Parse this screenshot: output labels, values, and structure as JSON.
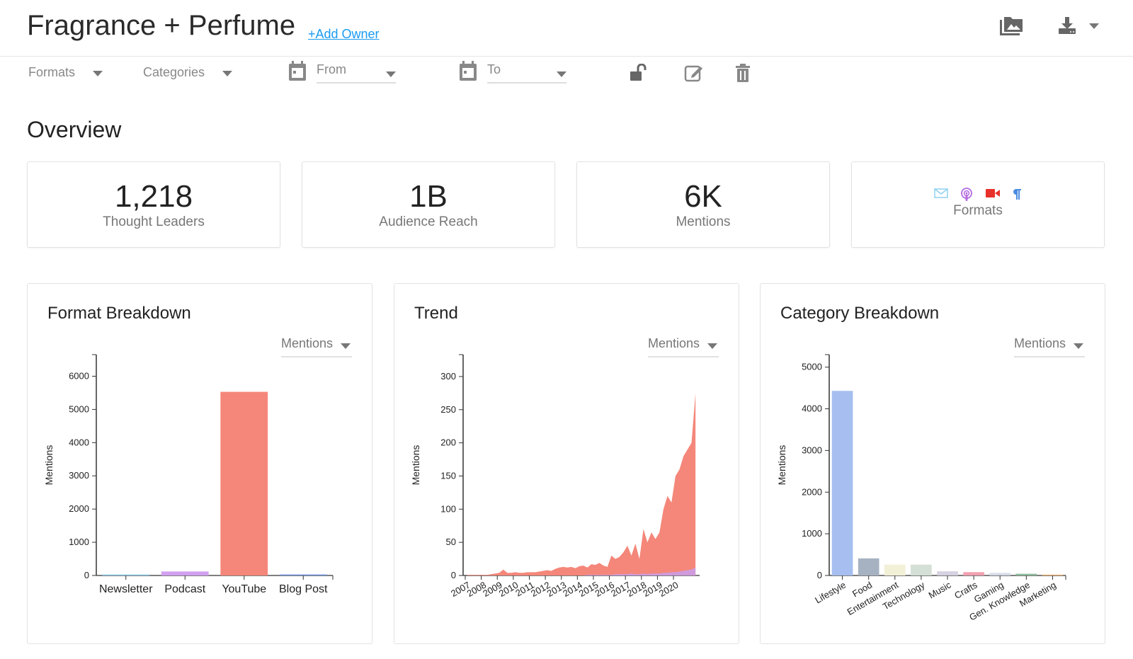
{
  "header": {
    "title": "Fragrance + Perfume",
    "add_owner": "+Add Owner",
    "icons": [
      "gallery-icon",
      "download-icon",
      "chevron-down-icon"
    ]
  },
  "toolbar": {
    "formats": "Formats",
    "categories": "Categories",
    "from": "From",
    "to": "To",
    "icons": [
      "calendar-icon",
      "lock-open-icon",
      "edit-icon",
      "trash-icon"
    ]
  },
  "overview": {
    "title": "Overview",
    "cards": [
      {
        "value": "1,218",
        "label": "Thought Leaders"
      },
      {
        "value": "1B",
        "label": "Audience Reach"
      },
      {
        "value": "6K",
        "label": "Mentions"
      },
      {
        "label": "Formats",
        "icons": [
          "mail-icon",
          "podcast-icon",
          "video-icon",
          "paragraph-icon"
        ],
        "icon_colors": [
          "#8fd0f0",
          "#b46ae0",
          "#e8312a",
          "#4a8be0"
        ]
      }
    ]
  },
  "panels": [
    {
      "title": "Format Breakdown",
      "metric": "Mentions"
    },
    {
      "title": "Trend",
      "metric": "Mentions"
    },
    {
      "title": "Category Breakdown",
      "metric": "Mentions"
    }
  ],
  "chart_data": [
    {
      "type": "bar",
      "title": "Format Breakdown",
      "ylabel": "Mentions",
      "ylim": [
        0,
        6650
      ],
      "yticks": [
        0,
        1000,
        2000,
        3000,
        4000,
        5000,
        6000
      ],
      "categories": [
        "Newsletter",
        "Podcast",
        "YouTube",
        "Blog Post"
      ],
      "values": [
        30,
        120,
        5530,
        30
      ],
      "colors": [
        "#8fd0f0",
        "#d2a0f0",
        "#f4877a",
        "#6f94e0"
      ]
    },
    {
      "type": "area",
      "title": "Trend",
      "ylabel": "Mentions",
      "ylim": [
        0,
        333
      ],
      "yticks": [
        0,
        50,
        100,
        150,
        200,
        250,
        300
      ],
      "xticks": [
        "2007",
        "2008",
        "2009",
        "2010",
        "2011",
        "2012",
        "2013",
        "2014",
        "2015",
        "2016",
        "2017",
        "2018",
        "2019",
        "2020"
      ],
      "x": [
        "2007-Q1",
        "2007-Q2",
        "2007-Q3",
        "2007-Q4",
        "2008-Q1",
        "2008-Q2",
        "2008-Q3",
        "2008-Q4",
        "2009-Q1",
        "2009-Q2",
        "2009-Q3",
        "2009-Q4",
        "2010-Q1",
        "2010-Q2",
        "2010-Q3",
        "2010-Q4",
        "2011-Q1",
        "2011-Q2",
        "2011-Q3",
        "2011-Q4",
        "2012-Q1",
        "2012-Q2",
        "2012-Q3",
        "2012-Q4",
        "2013-Q1",
        "2013-Q2",
        "2013-Q3",
        "2013-Q4",
        "2014-Q1",
        "2014-Q2",
        "2014-Q3",
        "2014-Q4",
        "2015-Q1",
        "2015-Q2",
        "2015-Q3",
        "2015-Q4",
        "2016-Q1",
        "2016-Q2",
        "2016-Q3",
        "2016-Q4",
        "2017-Q1",
        "2017-Q2",
        "2017-Q3",
        "2017-Q4",
        "2018-Q1",
        "2018-Q2",
        "2018-Q3",
        "2018-Q4",
        "2019-Q1",
        "2019-Q2",
        "2019-Q3",
        "2019-Q4",
        "2020-Q1",
        "2020-Q2",
        "2020-Q3",
        "2020-Q4",
        "2021-Q1",
        "2021-Q2"
      ],
      "series": [
        {
          "values": [
            1,
            1,
            1,
            1,
            1,
            1,
            2,
            3,
            4,
            9,
            4,
            4,
            5,
            4,
            4,
            5,
            5,
            5,
            6,
            7,
            8,
            7,
            10,
            12,
            13,
            12,
            13,
            11,
            14,
            15,
            12,
            17,
            16,
            19,
            15,
            13,
            30,
            25,
            28,
            35,
            45,
            30,
            48,
            25,
            70,
            50,
            65,
            55,
            65,
            100,
            120,
            110,
            150,
            160,
            180,
            190,
            200,
            275
          ],
          "color": "#f4877a"
        },
        {
          "values": [
            0,
            0,
            0,
            0,
            0,
            0,
            0,
            0,
            0,
            0,
            0,
            0,
            0,
            0,
            0,
            0,
            0,
            0,
            0,
            0,
            0,
            0,
            0,
            0,
            0,
            0,
            0,
            0,
            0,
            0,
            1,
            1,
            1,
            1,
            1,
            1,
            1,
            2,
            2,
            2,
            2,
            3,
            2,
            2,
            3,
            2,
            3,
            3,
            3,
            4,
            4,
            5,
            5,
            6,
            7,
            8,
            9,
            12
          ],
          "color": "#c5a0f5"
        }
      ]
    },
    {
      "type": "bar",
      "title": "Category Breakdown",
      "ylabel": "Mentions",
      "ylim": [
        0,
        5300
      ],
      "yticks": [
        0,
        1000,
        2000,
        3000,
        4000,
        5000
      ],
      "categories": [
        "Lifestyle",
        "Food",
        "Entertainment",
        "Technology",
        "Music",
        "Crafts",
        "Gaming",
        "Gen. Knowledge",
        "Marketing"
      ],
      "values": [
        4430,
        410,
        260,
        260,
        100,
        80,
        60,
        40,
        20
      ],
      "colors": [
        "#a6bff0",
        "#a6b2c2",
        "#f2f0d6",
        "#d4e0d6",
        "#d6d2e2",
        "#f2a0b0",
        "#d4dce8",
        "#8cb89a",
        "#f0b070"
      ]
    }
  ]
}
